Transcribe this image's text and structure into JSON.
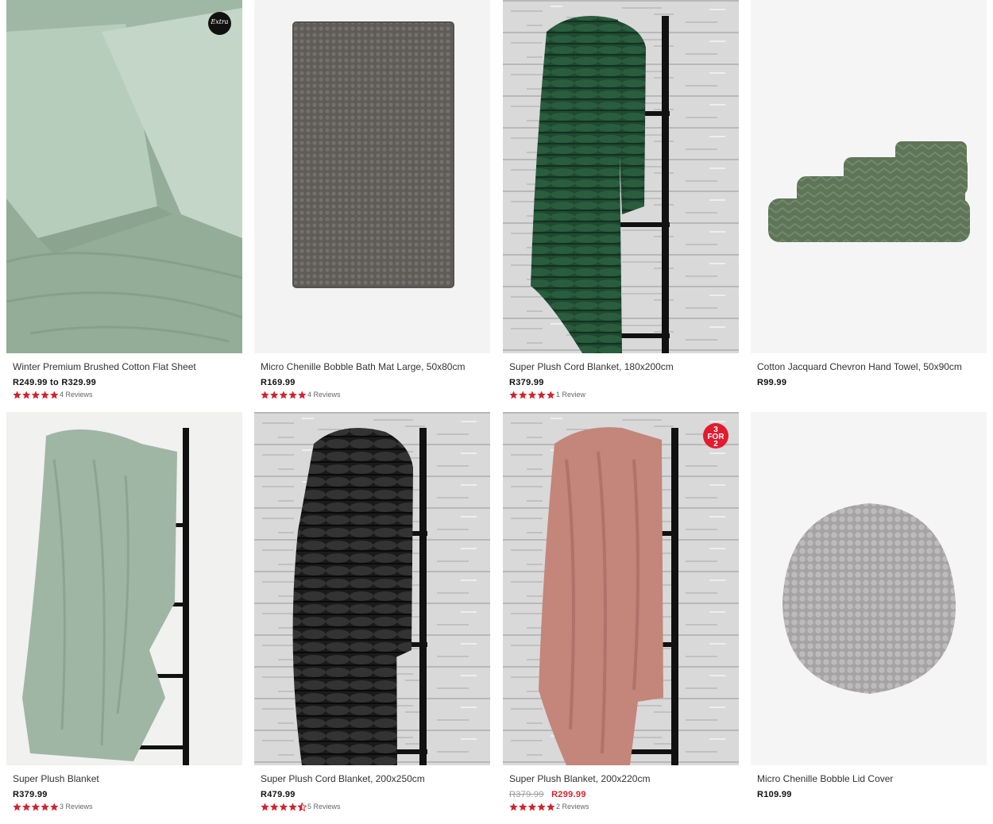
{
  "products": [
    {
      "title": "Winter Premium Brushed Cotton Flat Sheet",
      "price": "R249.99 to R329.99",
      "rating": 5,
      "reviews": "4 Reviews",
      "badge": "extra"
    },
    {
      "title": "Micro Chenille Bobble Bath Mat Large, 50x80cm",
      "price": "R169.99",
      "rating": 5,
      "reviews": "4 Reviews"
    },
    {
      "title": "Super Plush Cord Blanket, 180x200cm",
      "price": "R379.99",
      "rating": 5,
      "reviews": "1 Review"
    },
    {
      "title": "Cotton Jacquard Chevron Hand Towel, 50x90cm",
      "price": "R99.99"
    },
    {
      "title": "Super Plush Blanket",
      "price": "R379.99",
      "rating": 5,
      "reviews": "3 Reviews"
    },
    {
      "title": "Super Plush Cord Blanket, 200x250cm",
      "price": "R479.99",
      "rating": 4.5,
      "reviews": "5 Reviews"
    },
    {
      "title": "Super Plush Blanket, 200x220cm",
      "was_price": "R379.99",
      "sale_price": "R299.99",
      "rating": 5,
      "reviews": "2 Reviews",
      "badge": "3 FOR 2"
    },
    {
      "title": "Micro Chenille Bobble Lid Cover",
      "price": "R109.99"
    }
  ],
  "badges": {
    "extra": "Extra",
    "promo_line1": "3",
    "promo_line2": "FOR",
    "promo_line3": "2"
  },
  "colors": {
    "star": "#d0232f",
    "sale": "#d0232f",
    "promo_badge": "#e21b2e"
  },
  "icons": {
    "star": "star-icon",
    "half_star": "half-star-icon"
  }
}
